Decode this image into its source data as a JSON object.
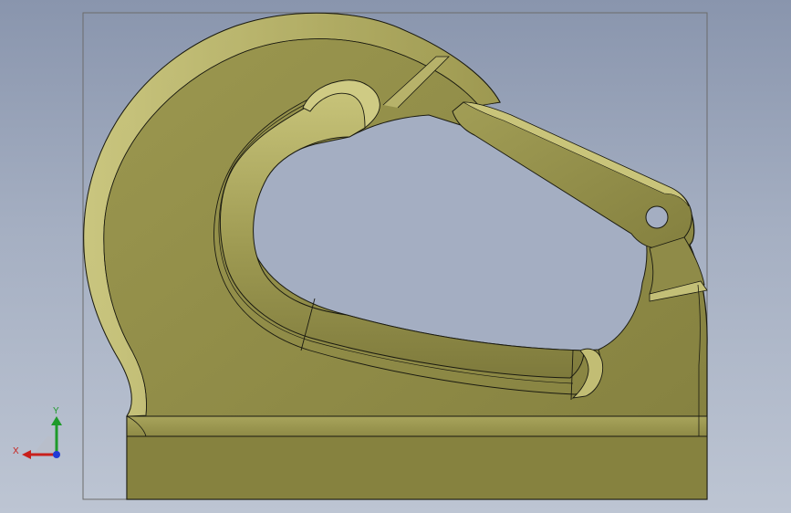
{
  "viewport": {
    "background_top": "#8995ad",
    "background_bottom": "#bdc5d3",
    "model": {
      "part": "crane-hook",
      "face_color": "#8a8646",
      "highlight_color": "#c9c47a",
      "edge_color": "#1a1a10"
    }
  },
  "triad": {
    "x_label": "X",
    "y_label": "Y",
    "x_color": "#c8201c",
    "y_color": "#1e9a2a",
    "z_color": "#1f3ad6"
  }
}
